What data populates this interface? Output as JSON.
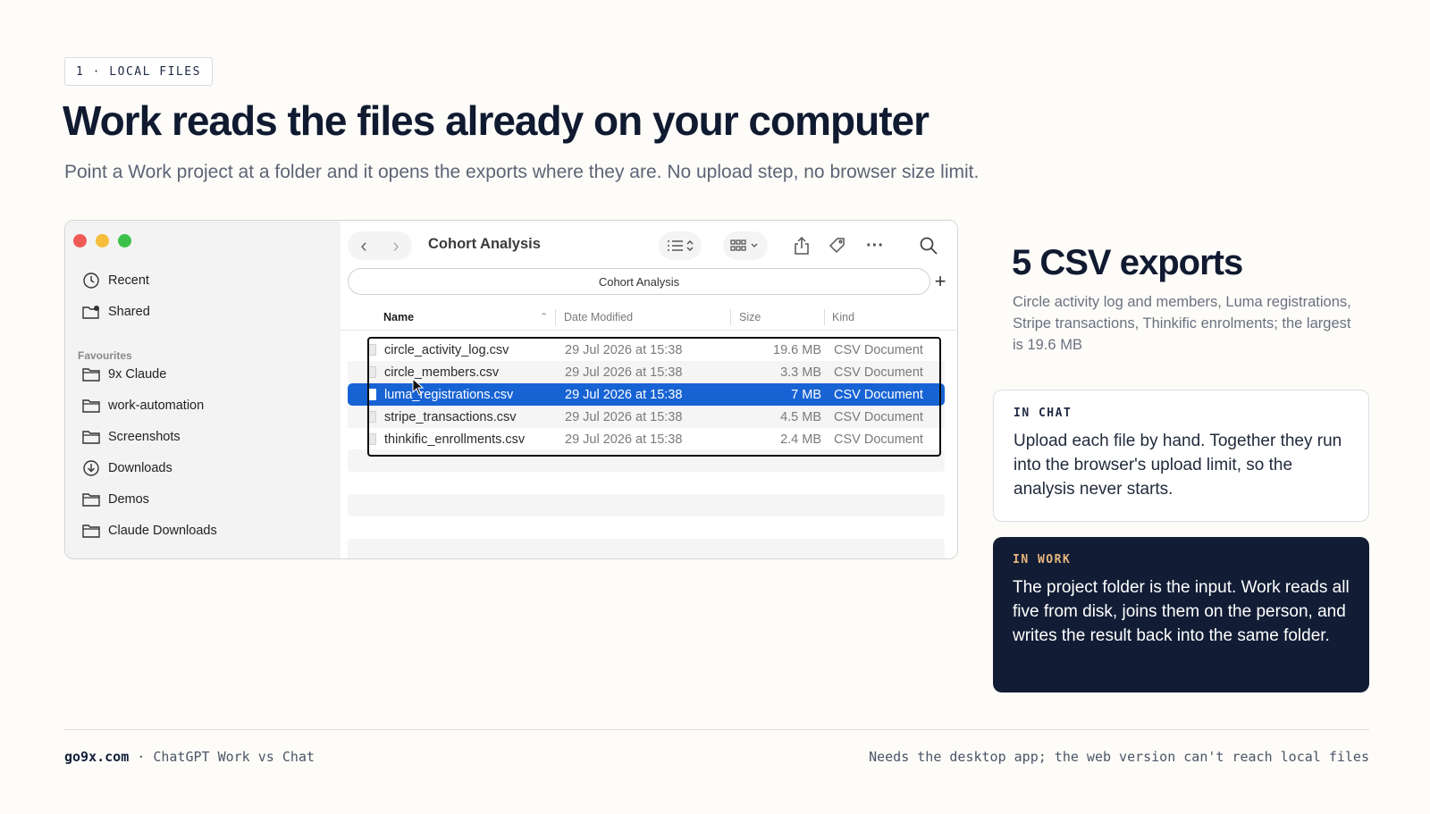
{
  "eyebrow": "1 · LOCAL FILES",
  "title": "Work reads the files already on your computer",
  "subtitle": "Point a Work project at a folder and it opens the exports where they are. No upload step, no browser size limit.",
  "finder": {
    "sidebar": {
      "items_top": [
        {
          "label": "Recent",
          "icon": "clock-icon"
        },
        {
          "label": "Shared",
          "icon": "shared-folder-icon"
        }
      ],
      "favourites_heading": "Favourites",
      "favourites": [
        {
          "label": "9x Claude",
          "icon": "folder-icon"
        },
        {
          "label": "work-automation",
          "icon": "folder-icon"
        },
        {
          "label": "Screenshots",
          "icon": "folder-icon"
        },
        {
          "label": "Downloads",
          "icon": "download-icon"
        },
        {
          "label": "Demos",
          "icon": "folder-icon"
        },
        {
          "label": "Claude Downloads",
          "icon": "folder-icon"
        }
      ]
    },
    "window_title": "Cohort Analysis",
    "path_bar": "Cohort Analysis",
    "columns": {
      "name": "Name",
      "date": "Date Modified",
      "size": "Size",
      "kind": "Kind"
    },
    "files": [
      {
        "name": "circle_activity_log.csv",
        "date": "29 Jul 2026 at 15:38",
        "size": "19.6 MB",
        "kind": "CSV Document",
        "selected": false
      },
      {
        "name": "circle_members.csv",
        "date": "29 Jul 2026 at 15:38",
        "size": "3.3 MB",
        "kind": "CSV Document",
        "selected": false
      },
      {
        "name": "luma_registrations.csv",
        "date": "29 Jul 2026 at 15:38",
        "size": "7 MB",
        "kind": "CSV Document",
        "selected": true
      },
      {
        "name": "stripe_transactions.csv",
        "date": "29 Jul 2026 at 15:38",
        "size": "4.5 MB",
        "kind": "CSV Document",
        "selected": false
      },
      {
        "name": "thinkific_enrollments.csv",
        "date": "29 Jul 2026 at 15:38",
        "size": "2.4 MB",
        "kind": "CSV Document",
        "selected": false
      }
    ]
  },
  "stat": {
    "headline": "5 CSV exports",
    "description": "Circle activity log and members, Luma registrations, Stripe transactions, Thinkific enrolments; the largest is 19.6 MB"
  },
  "chat_card": {
    "label": "IN CHAT",
    "body": "Upload each file by hand. Together they run into the browser's upload limit, so the analysis never starts."
  },
  "work_card": {
    "label": "IN WORK",
    "body": "The project folder is the input. Work reads all five from disk, joins them on the person, and writes the result back into the same folder."
  },
  "footer": {
    "site": "go9x.com",
    "separator": " · ",
    "context": "ChatGPT Work vs Chat",
    "note": "Needs the desktop app; the web version can't reach local files"
  },
  "colors": {
    "selection_blue": "#1763d4",
    "work_card_bg": "#121d35",
    "work_label": "#e8b67c"
  }
}
